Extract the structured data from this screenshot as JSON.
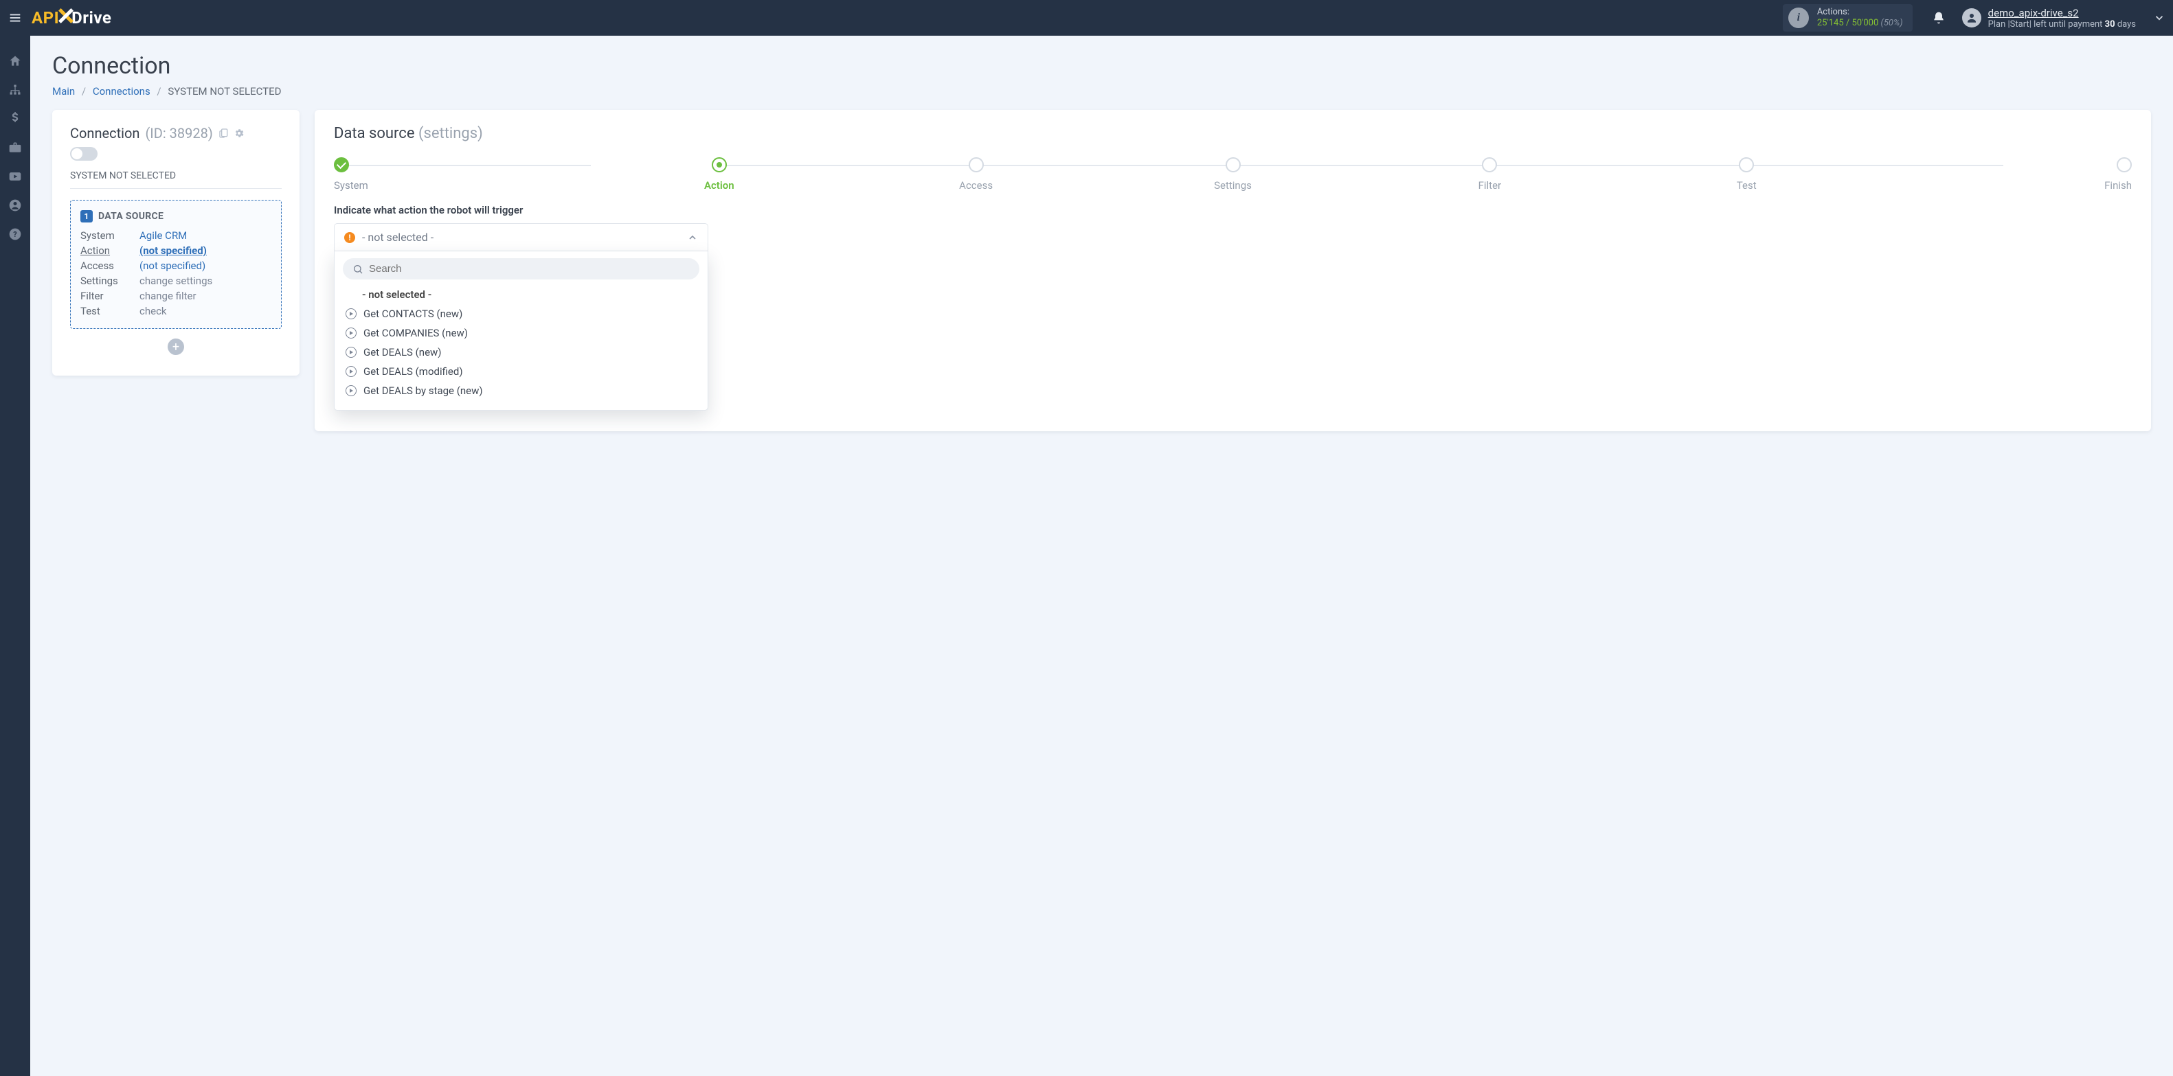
{
  "brand": {
    "api": "API",
    "drive": "Drive"
  },
  "topbar": {
    "actions_label": "Actions:",
    "actions_used": "25'145",
    "actions_total": "50'000",
    "actions_slash": " / ",
    "actions_pct": "(50%)",
    "user": {
      "name": "demo_apix-drive_s2",
      "plan_prefix": "Plan |",
      "plan_name": "Start",
      "plan_mid": "| left until payment ",
      "plan_days": "30",
      "plan_suffix": " days"
    }
  },
  "page": {
    "title": "Connection",
    "breadcrumb": {
      "main": "Main",
      "connections": "Connections",
      "current": "SYSTEM NOT SELECTED"
    }
  },
  "left": {
    "title": "Connection",
    "id_label": "(ID: 38928)",
    "subtitle": "SYSTEM NOT SELECTED",
    "ds_title": "DATA SOURCE",
    "ds_num": "1",
    "rows": {
      "system_k": "System",
      "system_v": "Agile CRM",
      "action_k": "Action",
      "action_v": "(not specified)",
      "access_k": "Access",
      "access_v": "(not specified)",
      "settings_k": "Settings",
      "settings_v": "change settings",
      "filter_k": "Filter",
      "filter_v": "change filter",
      "test_k": "Test",
      "test_v": "check"
    }
  },
  "right": {
    "title": "Data source",
    "title_muted": "(settings)",
    "steps": [
      "System",
      "Action",
      "Access",
      "Settings",
      "Filter",
      "Test",
      "Finish"
    ],
    "field_label": "Indicate what action the robot will trigger",
    "combo_placeholder": "- not selected -",
    "search_placeholder": "Search",
    "options_header": "- not selected -",
    "options": [
      "Get CONTACTS (new)",
      "Get COMPANIES (new)",
      "Get DEALS (new)",
      "Get DEALS (modified)",
      "Get DEALS by stage (new)"
    ]
  }
}
